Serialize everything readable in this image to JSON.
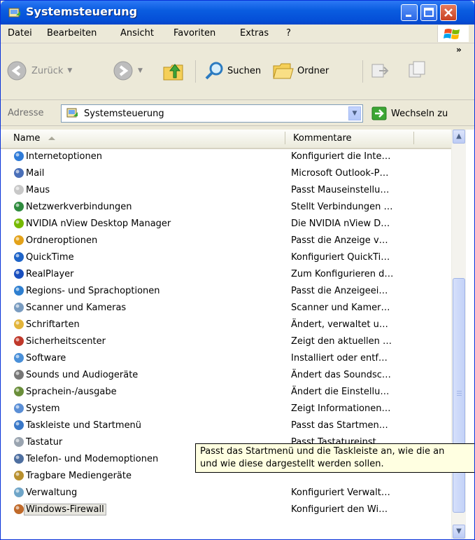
{
  "window": {
    "title": "Systemsteuerung"
  },
  "menu": [
    "Datei",
    "Bearbeiten",
    "Ansicht",
    "Favoriten",
    "Extras",
    "?"
  ],
  "toolbar": {
    "back": "Zurück",
    "search": "Suchen",
    "folders": "Ordner",
    "overflow": "»"
  },
  "address": {
    "label": "Adresse",
    "value": "Systemsteuerung",
    "go": "Wechseln zu"
  },
  "columns": {
    "name": "Name",
    "comment": "Kommentare"
  },
  "items": [
    {
      "name": "Internetoptionen",
      "comment": "Konfiguriert die Inte…"
    },
    {
      "name": "Mail",
      "comment": "Microsoft Outlook-P…"
    },
    {
      "name": "Maus",
      "comment": "Passt Mauseinstellu…"
    },
    {
      "name": "Netzwerkverbindungen",
      "comment": "Stellt Verbindungen …"
    },
    {
      "name": "NVIDIA nView Desktop Manager",
      "comment": "Die NVIDIA nView D…"
    },
    {
      "name": "Ordneroptionen",
      "comment": "Passt die Anzeige v…"
    },
    {
      "name": "QuickTime",
      "comment": "Konfiguriert QuickTi…"
    },
    {
      "name": "RealPlayer",
      "comment": "Zum Konfigurieren d…"
    },
    {
      "name": "Regions- und Sprachoptionen",
      "comment": "Passt die Anzeigeei…"
    },
    {
      "name": "Scanner und Kameras",
      "comment": "Scanner und Kamer…"
    },
    {
      "name": "Schriftarten",
      "comment": "Ändert, verwaltet u…"
    },
    {
      "name": "Sicherheitscenter",
      "comment": "Zeigt den aktuellen …"
    },
    {
      "name": "Software",
      "comment": "Installiert oder entf…"
    },
    {
      "name": "Sounds und Audiogeräte",
      "comment": "Ändert das Soundsc…"
    },
    {
      "name": "Sprachein-/ausgabe",
      "comment": "Ändert die Einstellu…"
    },
    {
      "name": "System",
      "comment": "Zeigt Informationen…"
    },
    {
      "name": "Taskleiste und Startmenü",
      "comment": "Passt das Startmen…"
    },
    {
      "name": "Tastatur",
      "comment": "Passt Tastatureinst…"
    },
    {
      "name": "Telefon- und Modemoptionen",
      "comment": ""
    },
    {
      "name": "Tragbare Mediengeräte",
      "comment": ""
    },
    {
      "name": "Verwaltung",
      "comment": "Konfiguriert Verwalt…"
    },
    {
      "name": "Windows-Firewall",
      "comment": "Konfiguriert den Wi…"
    }
  ],
  "tooltip": {
    "line1": "Passt das Startmenü und die Taskleiste an, wie die an",
    "line2": "und wie diese dargestellt werden sollen."
  }
}
